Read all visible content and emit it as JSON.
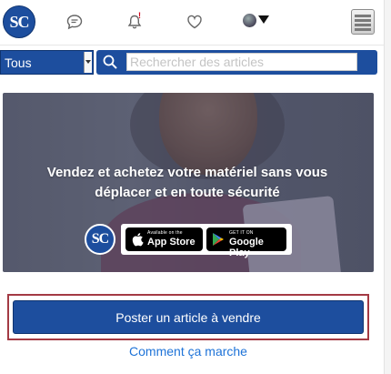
{
  "nav": {
    "logo": "SC",
    "icons": [
      "chat-icon",
      "bell-icon",
      "heart-icon",
      "avatar",
      "menu-icon"
    ],
    "notification_badge": "!"
  },
  "search": {
    "category": "Tous",
    "placeholder": "Rechercher des articles"
  },
  "banner": {
    "title": "Vendez et achetez votre matériel sans vous déplacer et en toute sécurité",
    "logo": "SC",
    "app_store": {
      "small": "Available on the",
      "big": "App Store"
    },
    "google_play": {
      "small": "GET IT ON",
      "big": "Google Play"
    }
  },
  "actions": {
    "post_label": "Poster un article à vendre",
    "how_label": "Comment ça marche"
  },
  "colors": {
    "brand": "#1d4e9e",
    "link": "#1e73d8",
    "highlight_border": "#a33a44"
  }
}
